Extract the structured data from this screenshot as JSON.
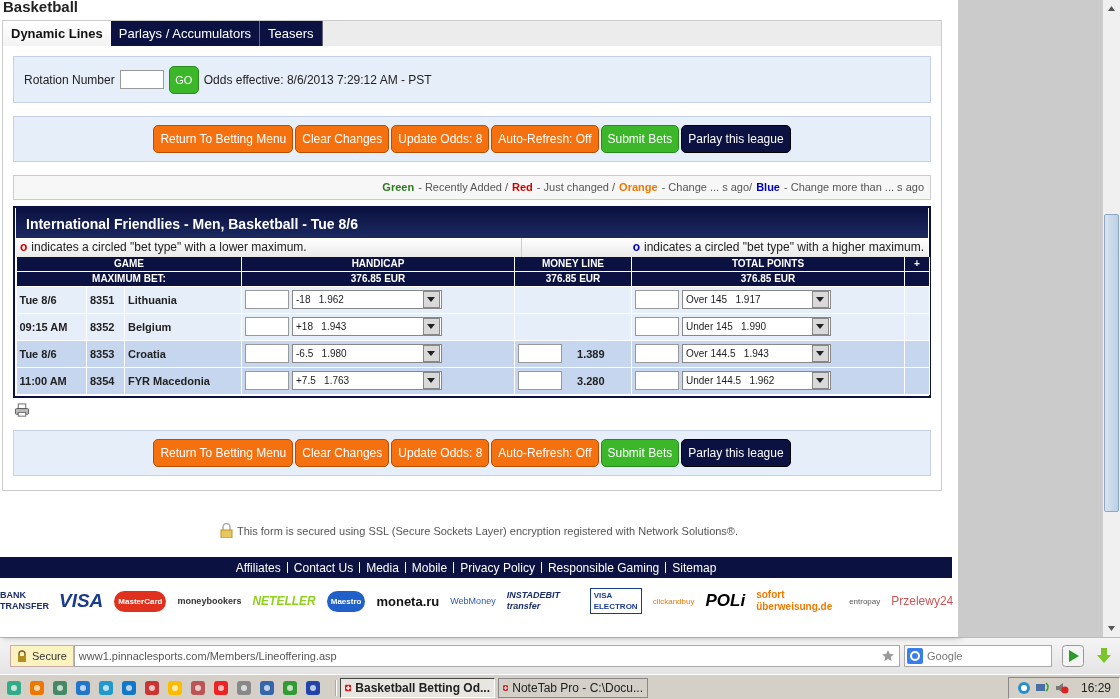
{
  "page_title": "Basketball",
  "tabs": [
    {
      "label": "Dynamic Lines",
      "selected": true
    },
    {
      "label": "Parlays / Accumulators",
      "selected": false
    },
    {
      "label": "Teasers",
      "selected": false
    }
  ],
  "rotation": {
    "label": "Rotation Number",
    "go": "GO",
    "odds_effective": "Odds effective: 8/6/2013 7:29:12 AM - PST"
  },
  "top_buttons": [
    {
      "label": "Return To Betting Menu",
      "kind": "orange"
    },
    {
      "label": "Clear Changes",
      "kind": "orange"
    },
    {
      "label": "Update Odds: 8",
      "kind": "orange"
    },
    {
      "label": "Auto-Refresh: Off",
      "kind": "orange"
    },
    {
      "label": "Submit Bets",
      "kind": "green"
    },
    {
      "label": "Parlay this league",
      "kind": "navy"
    }
  ],
  "legend": [
    {
      "label": "Green",
      "color": "#2a7a1e",
      "text": "- Recently Added /"
    },
    {
      "label": "Red",
      "color": "#d40000",
      "text": "- Just changed /"
    },
    {
      "label": "Orange",
      "color": "#f07800",
      "text": "- Change ... s ago/"
    },
    {
      "label": "Blue",
      "color": "#0000b8",
      "text": "- Change more than ... s ago"
    }
  ],
  "league": {
    "title": "International Friendlies - Men, Basketball - Tue 8/6",
    "notes": [
      {
        "mark": "o",
        "color": "#d40000",
        "text": "indicates a circled \"bet type\" with a lower maximum."
      },
      {
        "mark": "o",
        "color": "#0000b8",
        "text": "indicates a circled \"bet type\" with a higher maximum."
      }
    ],
    "columns": [
      "GAME",
      "HANDICAP",
      "MONEY LINE",
      "TOTAL POINTS",
      "+"
    ],
    "max_bet": {
      "label": "MAXIMUM BET:",
      "handicap": "376.85 EUR",
      "money_line": "376.85 EUR",
      "total_points": "376.85 EUR"
    },
    "events": [
      {
        "rows": [
          {
            "when": "Tue 8/6",
            "rotation": "8351",
            "team": "Lithuania",
            "handicap": "-18   1.962",
            "total": "Over 145   1.917"
          },
          {
            "when": "09:15 AM",
            "rotation": "8352",
            "team": "Belgium",
            "handicap": "+18   1.943",
            "total": "Under 145   1.990"
          }
        ]
      },
      {
        "rows": [
          {
            "when": "Tue 8/6",
            "rotation": "8353",
            "team": "Croatia",
            "handicap": "-6.5   1.980",
            "money_line": "1.389",
            "total": "Over 144.5   1.943"
          },
          {
            "when": "11:00 AM",
            "rotation": "8354",
            "team": "FYR Macedonia",
            "handicap": "+7.5   1.763",
            "money_line": "3.280",
            "total": "Under 144.5   1.962"
          }
        ]
      }
    ]
  },
  "bottom_buttons": [
    {
      "label": "Return To Betting Menu",
      "kind": "orange"
    },
    {
      "label": "Clear Changes",
      "kind": "orange"
    },
    {
      "label": "Update Odds: 8",
      "kind": "orange"
    },
    {
      "label": "Auto-Refresh: Off",
      "kind": "orange"
    },
    {
      "label": "Submit Bets",
      "kind": "green"
    },
    {
      "label": "Parlay this league",
      "kind": "navy"
    }
  ],
  "ssl_note": "This form is secured using SSL (Secure Sockets Layer) encryption registered with Network Solutions®.",
  "footer_links": [
    "Affiliates",
    "Contact Us",
    "Media",
    "Mobile",
    "Privacy Policy",
    "Responsible Gaming",
    "Sitemap"
  ],
  "payment_logos": [
    "BANK TRANSFER",
    "VISA",
    "MasterCard",
    "moneybookers",
    "NETELLER",
    "Maestro",
    "moneta.ru",
    "WebMoney",
    "INSTADEBIT transfer",
    "VISA ELECTRON",
    "clickandbuy",
    "POLi",
    "sofort überweisung.de",
    "entropay",
    "Przelewy24"
  ],
  "browser": {
    "security": "Secure",
    "url": "www1.pinnaclesports.com/Members/Lineoffering.asp",
    "search_placeholder": "Google"
  },
  "taskbar": {
    "tasks": [
      {
        "label": "Basketball Betting Od...",
        "selected": true
      },
      {
        "label": "NoteTab Pro  - C:\\Docu...",
        "selected": false
      }
    ],
    "clock": "16:29"
  }
}
